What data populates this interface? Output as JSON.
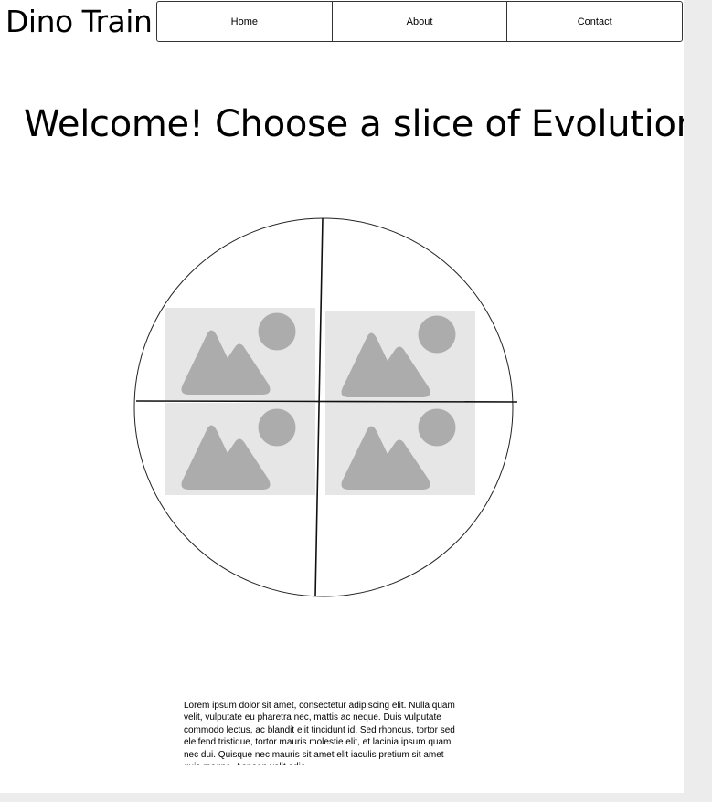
{
  "header": {
    "logo": "Dino Train",
    "nav": [
      {
        "label": "Home"
      },
      {
        "label": "About"
      },
      {
        "label": "Contact"
      }
    ]
  },
  "main": {
    "headline": "Welcome! Choose a slice of Evolution!",
    "wheel": {
      "slices": [
        {
          "icon": "image-placeholder-icon"
        },
        {
          "icon": "image-placeholder-icon"
        },
        {
          "icon": "image-placeholder-icon"
        },
        {
          "icon": "image-placeholder-icon"
        }
      ],
      "placeholder_bg": "#e6e6e6",
      "placeholder_fg": "#acacac"
    },
    "body_text": "Lorem ipsum dolor sit amet, consectetur adipiscing elit. Nulla quam velit, vulputate eu pharetra nec, mattis ac neque. Duis vulputate commodo lectus, ac blandit elit tincidunt id. Sed rhoncus, tortor sed eleifend tristique, tortor mauris molestie elit, et lacinia ipsum quam nec dui. Quisque nec mauris sit amet elit iaculis pretium sit amet quis magna. Aenean velit odio"
  }
}
